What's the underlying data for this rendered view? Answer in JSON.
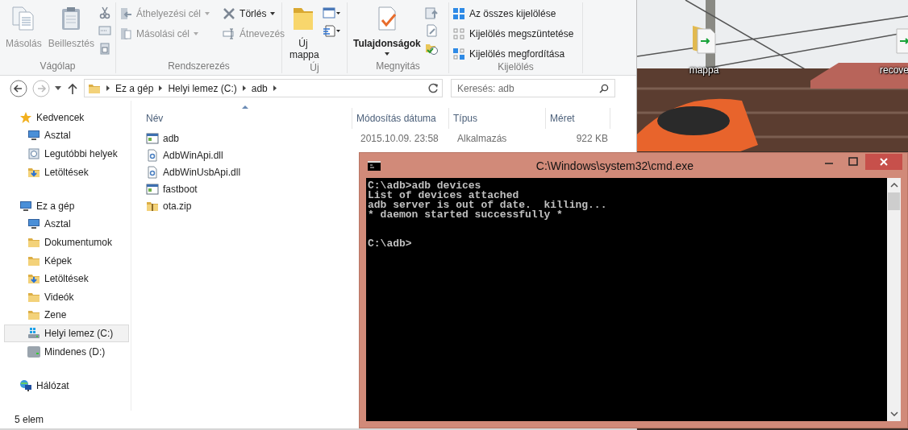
{
  "ribbon": {
    "groups": [
      {
        "label": "Vágólap",
        "buttons": [
          {
            "label": "Másolás",
            "disabled": true
          },
          {
            "label": "Beillesztés",
            "disabled": true
          }
        ]
      },
      {
        "label": "Rendszerezés",
        "buttons": [
          {
            "label": "Áthelyezési cél",
            "disabled": true
          },
          {
            "label": "Másolási cél",
            "disabled": true
          },
          {
            "label": "Törlés",
            "disabled": false
          },
          {
            "label": "Átnevezés",
            "disabled": true
          }
        ]
      },
      {
        "label": "Új",
        "buttons": [
          {
            "label": "Új mappa",
            "disabled": false
          }
        ]
      },
      {
        "label": "Megnyitás",
        "buttons": [
          {
            "label": "Tulajdonságok",
            "disabled": false
          }
        ]
      },
      {
        "label": "Kijelölés",
        "buttons": [
          {
            "label": "Az összes kijelölése",
            "disabled": false
          },
          {
            "label": "Kijelölés megszüntetése",
            "disabled": false
          },
          {
            "label": "Kijelölés megfordítása",
            "disabled": false
          }
        ]
      }
    ]
  },
  "address": {
    "path": [
      "Ez a gép",
      "Helyi lemez (C:)",
      "adb"
    ]
  },
  "search": {
    "placeholder": "Keresés: adb"
  },
  "sidebar": {
    "sections": [
      {
        "label": "Kedvencek",
        "selected": false,
        "children": [
          {
            "label": "Asztal",
            "selected": false
          },
          {
            "label": "Legutóbbi helyek",
            "selected": false
          },
          {
            "label": "Letöltések",
            "selected": false
          }
        ]
      },
      {
        "label": "Ez a gép",
        "selected": false,
        "children": [
          {
            "label": "Asztal",
            "selected": false
          },
          {
            "label": "Dokumentumok",
            "selected": false
          },
          {
            "label": "Képek",
            "selected": false
          },
          {
            "label": "Letöltések",
            "selected": false
          },
          {
            "label": "Videók",
            "selected": false
          },
          {
            "label": "Zene",
            "selected": false
          },
          {
            "label": "Helyi lemez (C:)",
            "selected": true
          },
          {
            "label": "Mindenes (D:)",
            "selected": false
          }
        ]
      },
      {
        "label": "Hálózat",
        "selected": false
      }
    ]
  },
  "table": {
    "columns": [
      "Név",
      "Módosítás dátuma",
      "Típus",
      "Méret"
    ],
    "rows": [
      {
        "kind": "app",
        "name": "adb",
        "date": "2015.10.09. 23:58",
        "type": "Alkalmazás",
        "size": "922 KB"
      },
      {
        "kind": "dll",
        "name": "AdbWinApi.dll"
      },
      {
        "kind": "dll",
        "name": "AdbWinUsbApi.dll"
      },
      {
        "kind": "app",
        "name": "fastboot"
      },
      {
        "kind": "zip",
        "name": "ota.zip"
      }
    ]
  },
  "status_bar": "5 elem",
  "desktop": {
    "icons": [
      {
        "label": "mappa",
        "kind": "folder"
      },
      {
        "label": "recove",
        "kind": "file"
      }
    ]
  },
  "console": {
    "title": "C:\\Windows\\system32\\cmd.exe",
    "lines": [
      "C:\\adb>adb devices",
      "List of devices attached",
      "adb server is out of date.  killing...",
      "* daemon started successfully *"
    ],
    "prompt": "C:\\adb>"
  }
}
